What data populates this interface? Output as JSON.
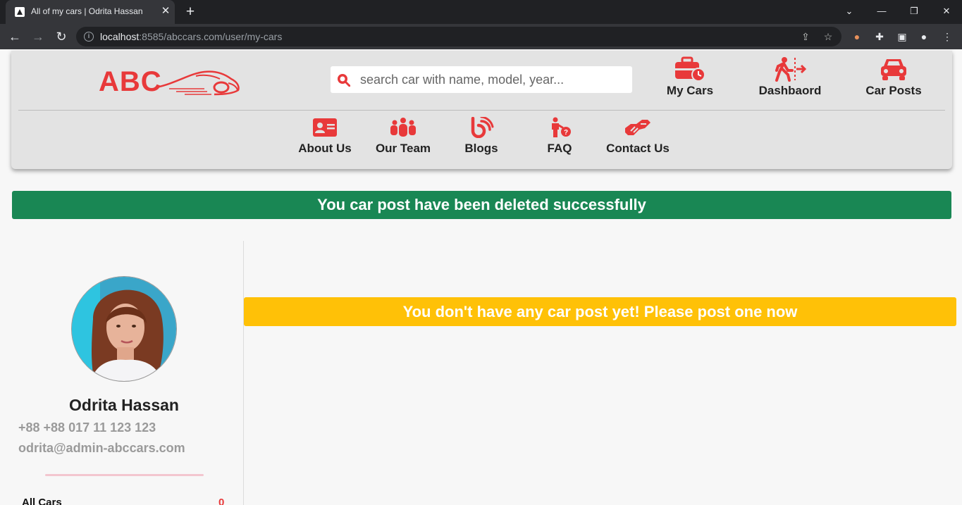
{
  "browser": {
    "tab_title": "All of my cars | Odrita Hassan",
    "tab_close": "✕",
    "new_tab": "+",
    "url_host": "localhost",
    "url_rest": ":8585/abccars.com/user/my-cars",
    "window_controls": [
      "⌄",
      "—",
      "❐",
      "✕"
    ]
  },
  "site": {
    "logo_text": "ABC",
    "accent_color": "#e8393a",
    "search": {
      "placeholder": "search car with name, model, year..."
    },
    "top_nav": [
      {
        "label": "My Cars",
        "icon": "briefcase-clock-icon"
      },
      {
        "label": "Dashbaord",
        "icon": "person-exit-icon"
      },
      {
        "label": "Car Posts",
        "icon": "car-icon"
      }
    ],
    "sub_nav": [
      {
        "label": "About Us",
        "icon": "id-card-icon"
      },
      {
        "label": "Our Team",
        "icon": "team-icon"
      },
      {
        "label": "Blogs",
        "icon": "blog-icon"
      },
      {
        "label": "FAQ",
        "icon": "person-question-icon"
      },
      {
        "label": "Contact Us",
        "icon": "handshake-icon"
      }
    ]
  },
  "alerts": {
    "success": "You car post have been deleted successfully",
    "success_color": "#198754",
    "warning": "You don't have any car post yet! Please post one now",
    "warning_color": "#ffc107"
  },
  "profile": {
    "name": "Odrita Hassan",
    "phone": "+88 +88 017 11 123 123",
    "email": "odrita@admin-abccars.com",
    "stats": [
      {
        "label": "All Cars",
        "value": "0"
      }
    ]
  }
}
